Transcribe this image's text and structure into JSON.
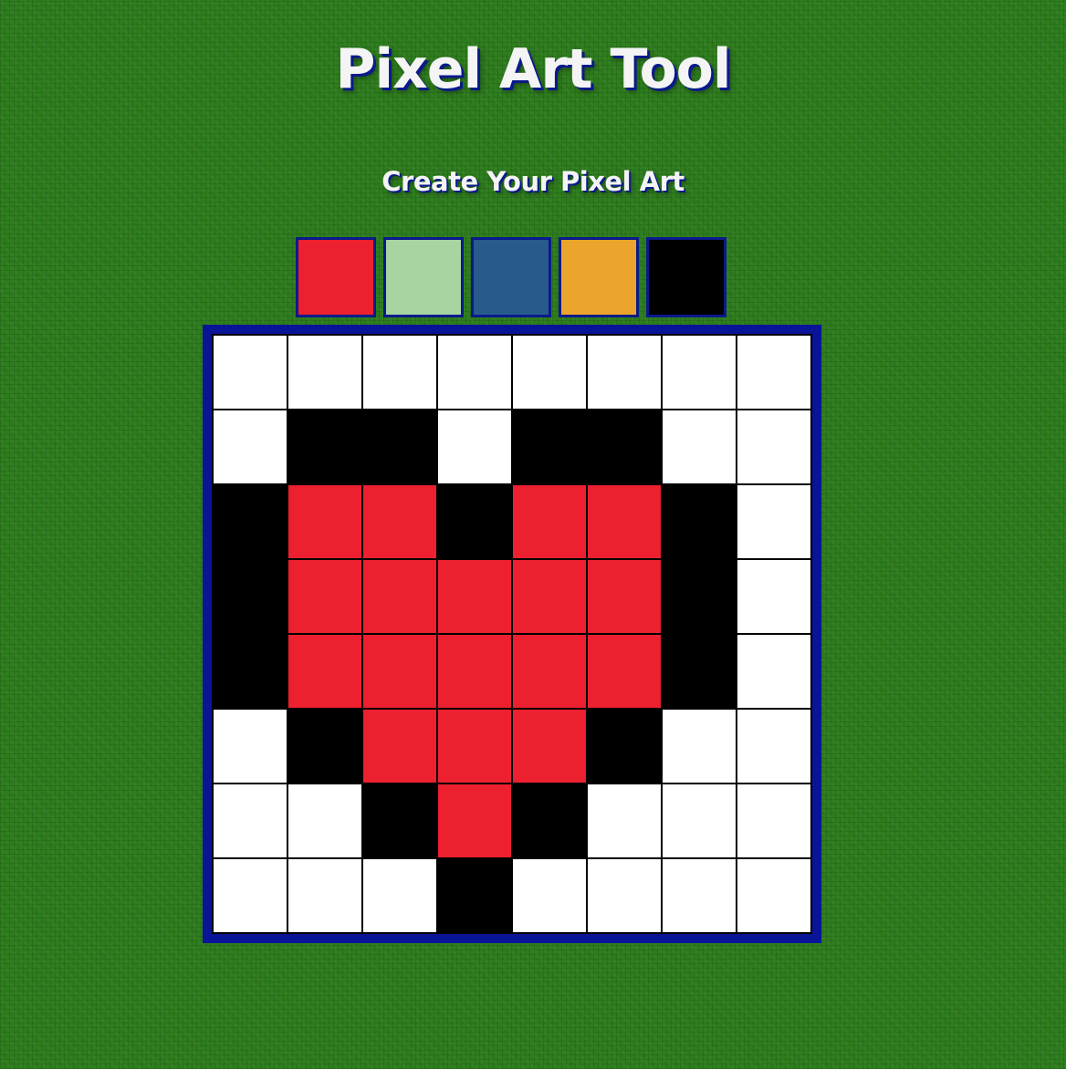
{
  "page": {
    "title": "Pixel Art Tool",
    "subtitle": "Create Your Pixel Art"
  },
  "palette": [
    {
      "name": "red",
      "color": "#ec202f"
    },
    {
      "name": "light-green",
      "color": "#a8d4a2"
    },
    {
      "name": "steel-blue",
      "color": "#285b8c"
    },
    {
      "name": "orange",
      "color": "#eca52c"
    },
    {
      "name": "black",
      "color": "#000000"
    }
  ],
  "colors": {
    "W": "#ffffff",
    "K": "#000000",
    "R": "#ec202f",
    "board_frame": "#0a1496"
  },
  "grid": {
    "rows": 8,
    "cols": 8,
    "cells": [
      [
        "W",
        "W",
        "W",
        "W",
        "W",
        "W",
        "W",
        "W"
      ],
      [
        "W",
        "K",
        "K",
        "W",
        "K",
        "K",
        "W",
        "W"
      ],
      [
        "K",
        "R",
        "R",
        "K",
        "R",
        "R",
        "K",
        "W"
      ],
      [
        "K",
        "R",
        "R",
        "R",
        "R",
        "R",
        "K",
        "W"
      ],
      [
        "K",
        "R",
        "R",
        "R",
        "R",
        "R",
        "K",
        "W"
      ],
      [
        "W",
        "K",
        "R",
        "R",
        "R",
        "K",
        "W",
        "W"
      ],
      [
        "W",
        "W",
        "K",
        "R",
        "K",
        "W",
        "W",
        "W"
      ],
      [
        "W",
        "W",
        "W",
        "K",
        "W",
        "W",
        "W",
        "W"
      ]
    ]
  }
}
